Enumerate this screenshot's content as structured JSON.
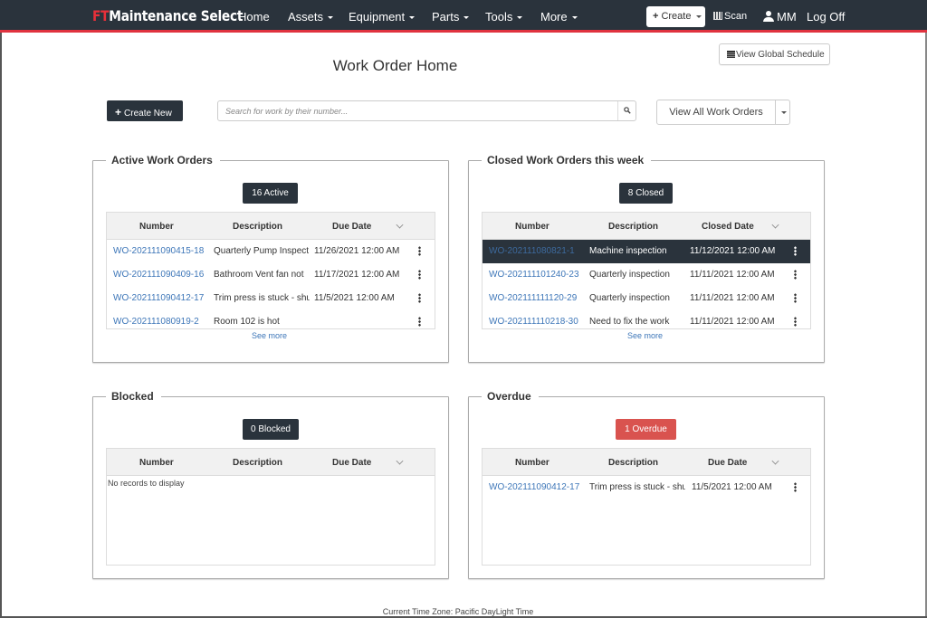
{
  "navbar": {
    "brand_prefix": "FT",
    "brand_name": "Maintenance Select",
    "items": [
      {
        "label": "Home",
        "dropdown": false
      },
      {
        "label": "Assets",
        "dropdown": true
      },
      {
        "label": "Equipment",
        "dropdown": true
      },
      {
        "label": "Parts",
        "dropdown": true
      },
      {
        "label": "Tools",
        "dropdown": true
      },
      {
        "label": "More",
        "dropdown": true
      }
    ],
    "create_label": "Create",
    "scan_label": "Scan",
    "user_initials": "MM",
    "logoff_label": "Log Off",
    "colors": {
      "bar": "#2a333c",
      "accent": "#e0333f"
    }
  },
  "header": {
    "title": "Work Order Home",
    "global_schedule_label": "View Global Schedule",
    "create_new_label": "Create New",
    "search_placeholder": "Search for work by their number...",
    "search_value": "",
    "view_all_label": "View All Work Orders"
  },
  "panels": {
    "active": {
      "title": "Active Work Orders",
      "badge": "16 Active",
      "columns": [
        "Number",
        "Description",
        "Due Date"
      ],
      "rows": [
        {
          "number": "WO-202111090415-18",
          "description": "Quarterly Pump Inspect",
          "date": "11/26/2021 12:00 AM"
        },
        {
          "number": "WO-202111090409-16",
          "description": "Bathroom Vent fan not",
          "date": "11/17/2021 12:00 AM"
        },
        {
          "number": "WO-202111090412-17",
          "description": "Trim press is stuck - shu",
          "date": "11/5/2021 12:00 AM"
        },
        {
          "number": "WO-202111080919-2",
          "description": "Room 102 is hot",
          "date": ""
        }
      ],
      "see_more": "See more"
    },
    "closed": {
      "title": "Closed Work Orders this week",
      "badge": "8 Closed",
      "columns": [
        "Number",
        "Description",
        "Closed Date"
      ],
      "rows": [
        {
          "number": "WO-202111080821-1",
          "description": "Machine inspection",
          "date": "11/12/2021 12:00 AM",
          "selected": true
        },
        {
          "number": "WO-202111101240-23",
          "description": "Quarterly inspection",
          "date": "11/11/2021 12:00 AM"
        },
        {
          "number": "WO-202111111120-29",
          "description": "Quarterly inspection",
          "date": "11/11/2021 12:00 AM"
        },
        {
          "number": "WO-202111110218-30",
          "description": "Need to fix the work",
          "date": "11/11/2021 12:00 AM"
        }
      ],
      "see_more": "See more"
    },
    "blocked": {
      "title": "Blocked",
      "badge": "0 Blocked",
      "columns": [
        "Number",
        "Description",
        "Due Date"
      ],
      "empty_text": "No records to display"
    },
    "overdue": {
      "title": "Overdue",
      "badge": "1 Overdue",
      "badge_color": "#d9534f",
      "columns": [
        "Number",
        "Description",
        "Due Date"
      ],
      "rows": [
        {
          "number": "WO-202111090412-17",
          "description": "Trim press is stuck - shu",
          "date": "11/5/2021 12:00 AM"
        }
      ]
    }
  },
  "footer": {
    "timezone": "Current Time Zone: Pacific DayLight Time"
  }
}
